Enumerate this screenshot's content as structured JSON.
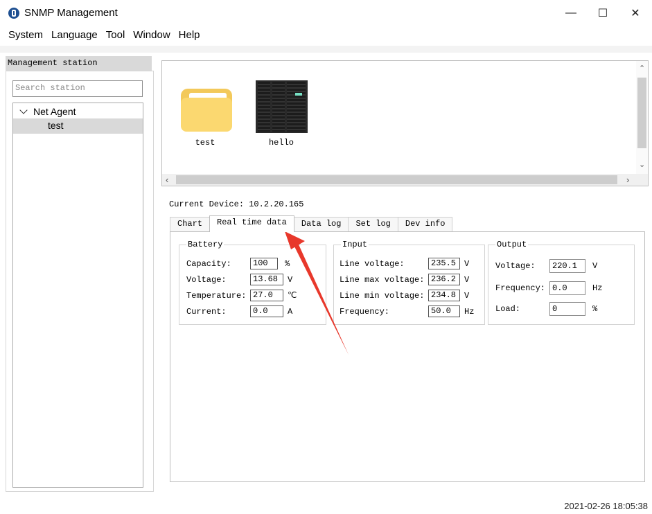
{
  "window": {
    "title": "SNMP Management",
    "minimize": "—",
    "maximize": "☐",
    "close": "✕"
  },
  "menu": [
    "System",
    "Language",
    "Tool",
    "Window",
    "Help"
  ],
  "sidebar": {
    "header": "Management station",
    "search_placeholder": "Search station",
    "tree": {
      "root": "Net Agent",
      "children": [
        "test"
      ]
    }
  },
  "devices": [
    {
      "label": "test",
      "icon": "folder-icon"
    },
    {
      "label": "hello",
      "icon": "ups-cabinet-icon"
    }
  ],
  "current_device": "Current Device: 10.2.20.165",
  "tabs": [
    "Chart",
    "Real time data",
    "Data log",
    "Set log",
    "Dev info"
  ],
  "active_tab": "Real time data",
  "battery": {
    "title": "Battery",
    "rows": [
      {
        "label": "Capacity:",
        "value": "100",
        "unit": "%"
      },
      {
        "label": "Voltage:",
        "value": "13.68",
        "unit": "V"
      },
      {
        "label": "Temperature:",
        "value": "27.0",
        "unit": "℃"
      },
      {
        "label": "Current:",
        "value": "0.0",
        "unit": "A"
      }
    ]
  },
  "input": {
    "title": "Input",
    "rows": [
      {
        "label": "Line voltage:",
        "value": "235.5",
        "unit": "V"
      },
      {
        "label": "Line max voltage:",
        "value": "236.2",
        "unit": "V"
      },
      {
        "label": "Line min voltage:",
        "value": "234.8",
        "unit": "V"
      },
      {
        "label": "Frequency:",
        "value": "50.0",
        "unit": "Hz"
      }
    ]
  },
  "output": {
    "title": "Output",
    "rows": [
      {
        "label": "Voltage:",
        "value": "220.1",
        "unit": "V"
      },
      {
        "label": "Frequency:",
        "value": "0.0",
        "unit": "Hz"
      },
      {
        "label": "Load:",
        "value": "0",
        "unit": "%"
      }
    ]
  },
  "status_time": "2021-02-26 18:05:38",
  "colors": {
    "annotation_arrow": "#e8382b",
    "selected_bg": "#d9d9d9",
    "folder": "#f3c95a"
  }
}
